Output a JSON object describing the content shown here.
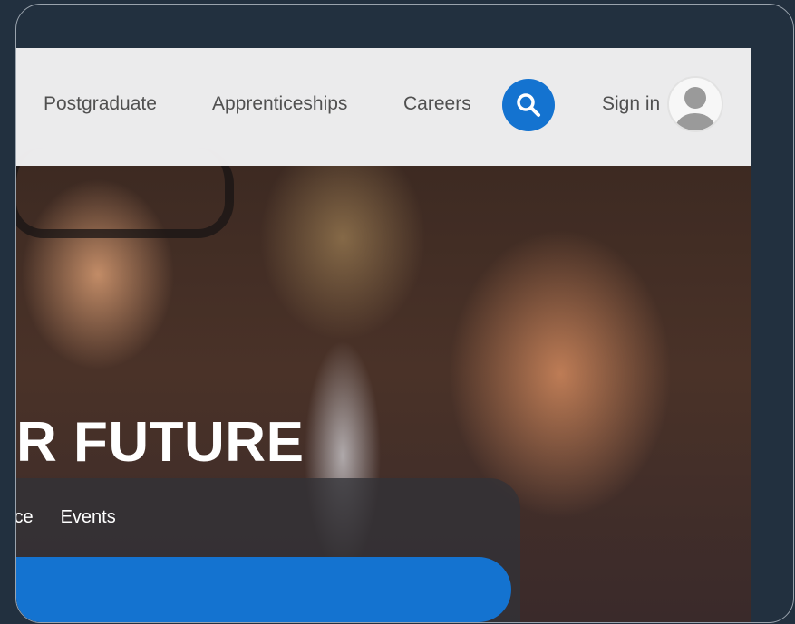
{
  "nav": {
    "items": [
      "Postgraduate",
      "Apprenticeships",
      "Careers"
    ],
    "signin_label": "Sign in"
  },
  "icons": {
    "search": "search-icon",
    "avatar": "user-avatar-icon"
  },
  "hero": {
    "headline": "R FUTURE",
    "links": [
      "ice",
      "Events"
    ]
  },
  "colors": {
    "accent": "#1473d0",
    "frame_bg": "#22303f",
    "navbar_bg": "#f4f3f4"
  }
}
